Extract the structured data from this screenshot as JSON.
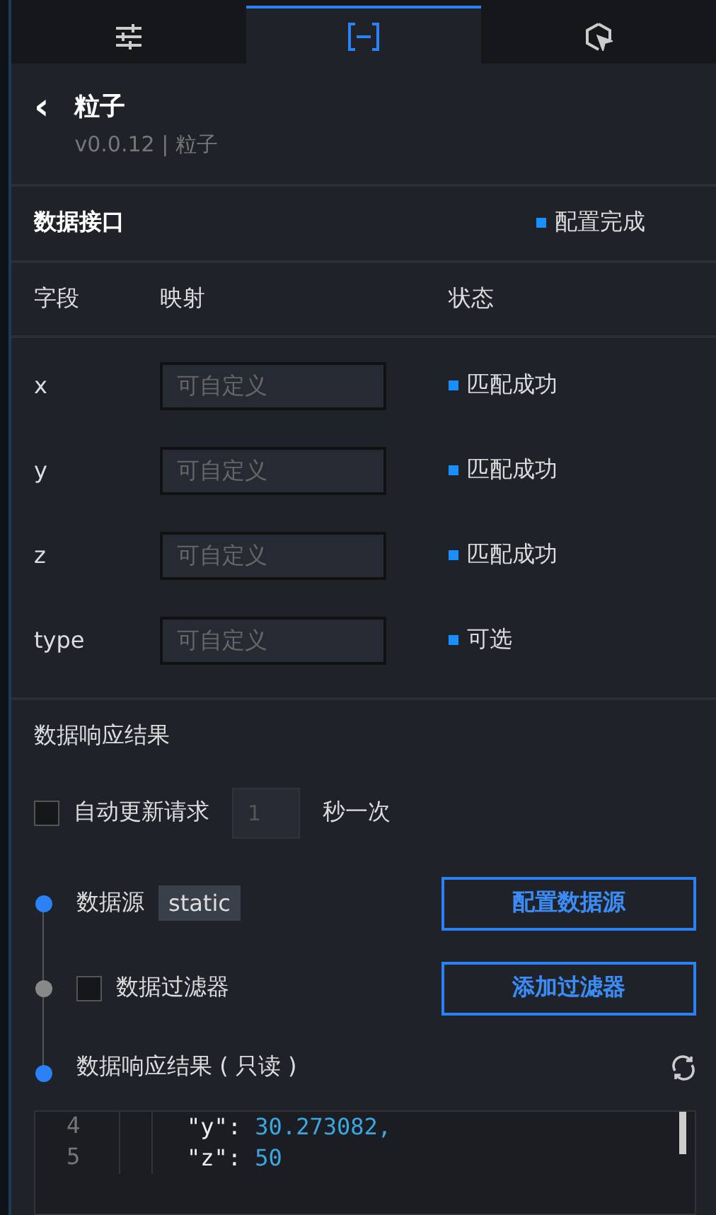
{
  "tabs": [
    {
      "kind": "sliders",
      "selected": false
    },
    {
      "kind": "brackets",
      "selected": true
    },
    {
      "kind": "cursor",
      "selected": false
    }
  ],
  "header": {
    "back": "‹",
    "title": "粒子",
    "subtitle": "v0.0.12 | 粒子"
  },
  "data_interface": {
    "title": "数据接口",
    "status": "配置完成",
    "color": "#1890ff"
  },
  "table": {
    "columns": [
      "字段",
      "映射",
      "状态"
    ],
    "rows": [
      {
        "field": "x",
        "placeholder": "可自定义",
        "status": "匹配成功",
        "color": "#1890ff"
      },
      {
        "field": "y",
        "placeholder": "可自定义",
        "status": "匹配成功",
        "color": "#1890ff"
      },
      {
        "field": "z",
        "placeholder": "可自定义",
        "status": "匹配成功",
        "color": "#1890ff"
      },
      {
        "field": "type",
        "placeholder": "可自定义",
        "status": "可选",
        "color": "#1890ff"
      }
    ]
  },
  "response_section": {
    "title": "数据响应结果"
  },
  "auto_update": {
    "label": "自动更新请求",
    "checked": false,
    "interval": "1",
    "unit": "秒一次"
  },
  "steps": [
    {
      "kind": "source",
      "label": "数据源",
      "tag": "static",
      "button": "配置数据源",
      "active": true
    },
    {
      "kind": "filter",
      "label": "数据过滤器",
      "checked": false,
      "button": "添加过滤器",
      "active": false
    },
    {
      "kind": "result",
      "label": "数据响应结果 ( 只读 )",
      "active": true
    }
  ],
  "code_lines": [
    {
      "number": "4",
      "key": "\"y\":",
      "value": "30.273082,"
    },
    {
      "number": "5",
      "key": "\"z\":",
      "value": "50"
    }
  ]
}
